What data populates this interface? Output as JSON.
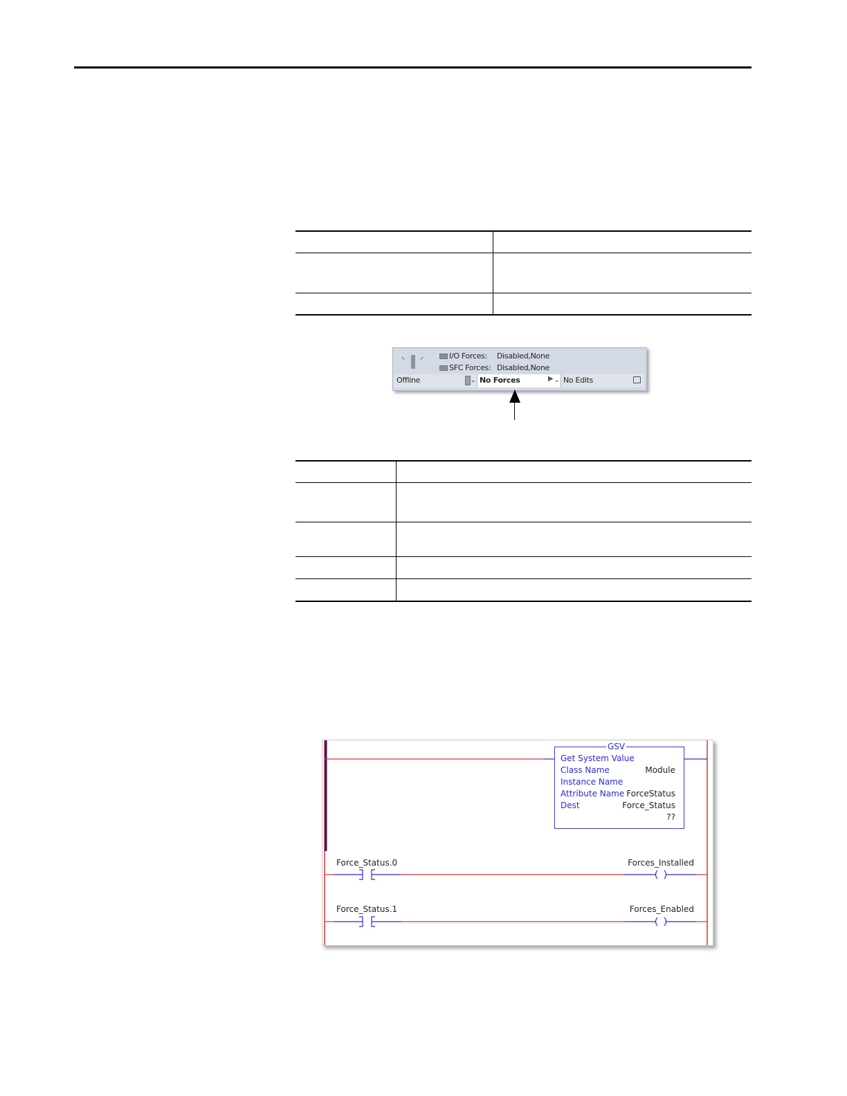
{
  "status_bar": {
    "io_forces_label": "I/O Forces:",
    "io_forces_value": "Disabled,None",
    "sfc_forces_label": "SFC Forces:",
    "sfc_forces_value": "Disabled,None",
    "mode": "Offline",
    "forces_status": "No Forces",
    "edits_status": "No Edits",
    "icons": [
      "controller-lamp-icon",
      "key-switch-icon",
      "play-dropdown-icon",
      "lock-icon"
    ]
  },
  "ladder": {
    "gsv": {
      "title": "GSV",
      "name": "Get System Value",
      "rows": [
        {
          "label": "Class Name",
          "value": "Module"
        },
        {
          "label": "Instance Name",
          "value": ""
        },
        {
          "label": "Attribute Name",
          "value": "ForceStatus"
        },
        {
          "label": "Dest",
          "value": "Force_Status"
        }
      ],
      "dest_value": "??"
    },
    "rungs": [
      {
        "contact": "Force_Status.0",
        "coil": "Forces_Installed"
      },
      {
        "contact": "Force_Status.1",
        "coil": "Forces_Enabled"
      }
    ],
    "colors": {
      "rail": "#e03131",
      "instruction": "#2b2bd8",
      "left_bar": "#1a1a8c"
    }
  }
}
